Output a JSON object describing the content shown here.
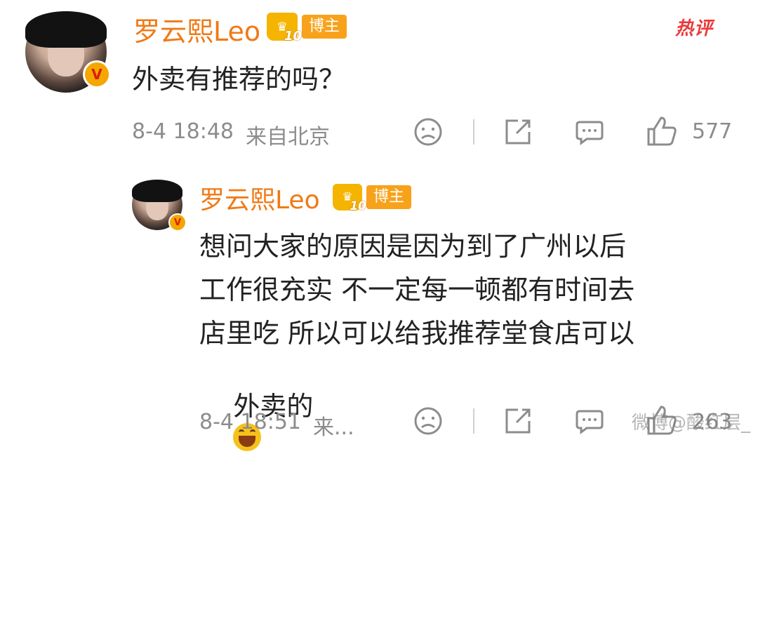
{
  "hot_label": "热评",
  "comment": {
    "author": "罗云熙Leo",
    "badge_level": "10",
    "badge_label": "博主",
    "verified_mark": "V",
    "text": "外卖有推荐的吗？",
    "time": "8-4 18:48",
    "location": "来自北京",
    "like_count": "577",
    "icons": [
      "dislike-icon",
      "share-icon",
      "comment-icon",
      "like-icon"
    ]
  },
  "reply": {
    "author": "罗云熙Leo",
    "badge_level": "10",
    "badge_label": "博主",
    "verified_mark": "V",
    "lines": [
      "想问大家的原因是因为到了广州以后",
      "工作很充实 不一定每一顿都有时间去",
      "店里吃 所以可以给我推荐堂食店可以",
      "外卖的"
    ],
    "time": "8-4 18:51",
    "location": "来...",
    "like_count": "263",
    "icons": [
      "dislike-icon",
      "share-icon",
      "comment-icon",
      "like-icon"
    ]
  },
  "watermark": "微博@酸红层_",
  "colors": {
    "author": "#f07a15",
    "badge": "#f7a21a",
    "hot": "#ea3a3a",
    "meta": "#8c8c8c"
  }
}
